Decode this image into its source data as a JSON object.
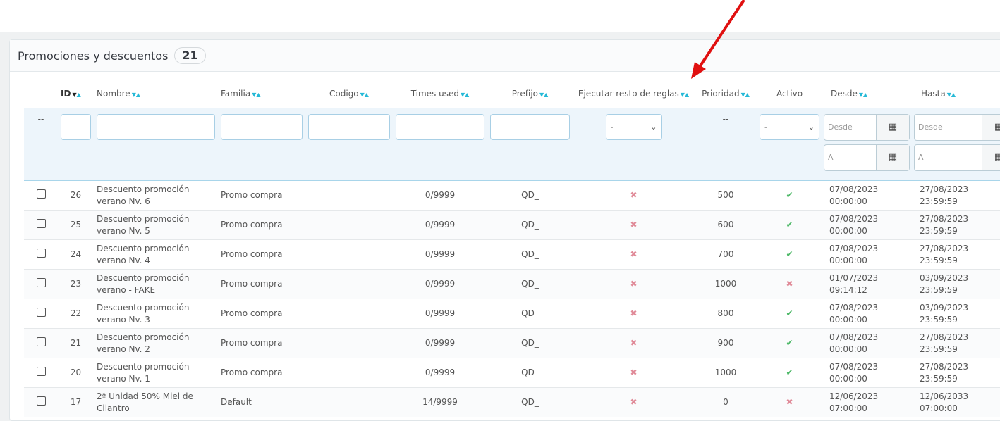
{
  "panel": {
    "title": "Promociones y descuentos",
    "count": "21"
  },
  "columns": {
    "id": "ID",
    "nombre": "Nombre",
    "familia": "Familia",
    "codigo": "Codigo",
    "times_used": "Times used",
    "prefijo": "Prefijo",
    "ejecutar": "Ejecutar resto de reglas",
    "prioridad": "Prioridad",
    "activo": "Activo",
    "desde": "Desde",
    "hasta": "Hasta"
  },
  "filters": {
    "bulk": "--",
    "ejecutar_value": "-",
    "prioridad": "--",
    "activo_value": "-",
    "desde_from_placeholder": "Desde",
    "desde_to_placeholder": "A",
    "hasta_from_placeholder": "Desde",
    "hasta_to_placeholder": "A"
  },
  "rows": [
    {
      "id": "26",
      "nombre": "Descuento promoción verano Nv. 6",
      "familia": "Promo compra",
      "codigo": "",
      "times_used": "0/9999",
      "prefijo": "QD_",
      "ejecutar": false,
      "prioridad": "500",
      "activo": true,
      "desde": "07/08/2023",
      "desde_t": "00:00:00",
      "hasta": "27/08/2023",
      "hasta_t": "23:59:59"
    },
    {
      "id": "25",
      "nombre": "Descuento promoción verano Nv. 5",
      "familia": "Promo compra",
      "codigo": "",
      "times_used": "0/9999",
      "prefijo": "QD_",
      "ejecutar": false,
      "prioridad": "600",
      "activo": true,
      "desde": "07/08/2023",
      "desde_t": "00:00:00",
      "hasta": "27/08/2023",
      "hasta_t": "23:59:59"
    },
    {
      "id": "24",
      "nombre": "Descuento promoción verano Nv. 4",
      "familia": "Promo compra",
      "codigo": "",
      "times_used": "0/9999",
      "prefijo": "QD_",
      "ejecutar": false,
      "prioridad": "700",
      "activo": true,
      "desde": "07/08/2023",
      "desde_t": "00:00:00",
      "hasta": "27/08/2023",
      "hasta_t": "23:59:59"
    },
    {
      "id": "23",
      "nombre": "Descuento promoción verano - FAKE",
      "familia": "Promo compra",
      "codigo": "",
      "times_used": "0/9999",
      "prefijo": "QD_",
      "ejecutar": false,
      "prioridad": "1000",
      "activo": false,
      "desde": "01/07/2023",
      "desde_t": "09:14:12",
      "hasta": "03/09/2023",
      "hasta_t": "23:59:59"
    },
    {
      "id": "22",
      "nombre": "Descuento promoción verano Nv. 3",
      "familia": "Promo compra",
      "codigo": "",
      "times_used": "0/9999",
      "prefijo": "QD_",
      "ejecutar": false,
      "prioridad": "800",
      "activo": true,
      "desde": "07/08/2023",
      "desde_t": "00:00:00",
      "hasta": "03/09/2023",
      "hasta_t": "23:59:59"
    },
    {
      "id": "21",
      "nombre": "Descuento promoción verano Nv. 2",
      "familia": "Promo compra",
      "codigo": "",
      "times_used": "0/9999",
      "prefijo": "QD_",
      "ejecutar": false,
      "prioridad": "900",
      "activo": true,
      "desde": "07/08/2023",
      "desde_t": "00:00:00",
      "hasta": "27/08/2023",
      "hasta_t": "23:59:59"
    },
    {
      "id": "20",
      "nombre": "Descuento promoción verano Nv. 1",
      "familia": "Promo compra",
      "codigo": "",
      "times_used": "0/9999",
      "prefijo": "QD_",
      "ejecutar": false,
      "prioridad": "1000",
      "activo": true,
      "desde": "07/08/2023",
      "desde_t": "00:00:00",
      "hasta": "27/08/2023",
      "hasta_t": "23:59:59"
    },
    {
      "id": "17",
      "nombre": "2ª Unidad 50% Miel de Cilantro",
      "familia": "Default",
      "codigo": "",
      "times_used": "14/9999",
      "prefijo": "QD_",
      "ejecutar": false,
      "prioridad": "0",
      "activo": false,
      "desde": "12/06/2023",
      "desde_t": "07:00:00",
      "hasta": "12/06/2033",
      "hasta_t": "07:00:00"
    }
  ],
  "colors": {
    "accent": "#25b9d7",
    "check": "#4cb866",
    "cross": "#e08a98",
    "annotation_arrow": "#e01010"
  }
}
